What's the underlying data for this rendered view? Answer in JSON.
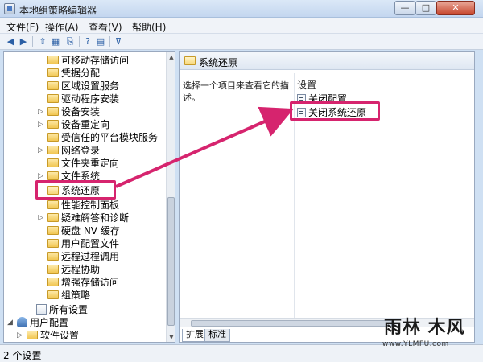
{
  "window": {
    "title": "本地组策略编辑器",
    "minimize": "—",
    "maximize": "□",
    "close": "✕"
  },
  "menu": [
    {
      "label": "文件(F)"
    },
    {
      "label": "操作(A)"
    },
    {
      "label": "查看(V)"
    },
    {
      "label": "帮助(H)"
    }
  ],
  "toolbar": [
    {
      "icon": "back-arrow-icon",
      "glyph": "◀"
    },
    {
      "icon": "forward-arrow-icon",
      "glyph": "▶"
    },
    {
      "icon": "up-folder-icon",
      "glyph": "⇧"
    },
    {
      "icon": "show-hide-tree-icon",
      "glyph": "▦"
    },
    {
      "icon": "export-list-icon",
      "glyph": "⎘"
    },
    {
      "icon": "help-icon",
      "glyph": "?"
    },
    {
      "icon": "properties-icon",
      "glyph": "▤"
    },
    {
      "icon": "filter-icon",
      "glyph": "⊽"
    }
  ],
  "tree": {
    "items": [
      {
        "label": "可移动存储访问"
      },
      {
        "label": "凭据分配"
      },
      {
        "label": "区域设置服务"
      },
      {
        "label": "驱动程序安装"
      },
      {
        "label": "设备安装"
      },
      {
        "label": "设备重定向"
      },
      {
        "label": "受信任的平台模块服务"
      },
      {
        "label": "网络登录"
      },
      {
        "label": "文件夹重定向"
      },
      {
        "label": "文件系统"
      },
      {
        "label": "系统还原"
      },
      {
        "label": "性能控制面板"
      },
      {
        "label": "疑难解答和诊断"
      },
      {
        "label": "硬盘 NV 缓存"
      },
      {
        "label": "用户配置文件"
      },
      {
        "label": "远程过程调用"
      },
      {
        "label": "远程协助"
      },
      {
        "label": "增强存储访问"
      },
      {
        "label": "组策略"
      },
      {
        "label": "所有设置"
      },
      {
        "label": "用户配置"
      },
      {
        "label": "软件设置"
      }
    ]
  },
  "right_pane": {
    "header": "系统还原",
    "description": "选择一个项目来查看它的描述。",
    "column_header": "设置",
    "settings": [
      {
        "label": "关闭配置"
      },
      {
        "label": "关闭系统还原"
      }
    ],
    "tabs": [
      {
        "label": "扩展"
      },
      {
        "label": "标准"
      }
    ]
  },
  "status": {
    "text": "2 个设置"
  },
  "watermark": {
    "logo": "雨林 木风",
    "url": "www.YLMFU.com"
  },
  "colors": {
    "highlight": "#d6246e",
    "frame": "#cfe0f3"
  }
}
